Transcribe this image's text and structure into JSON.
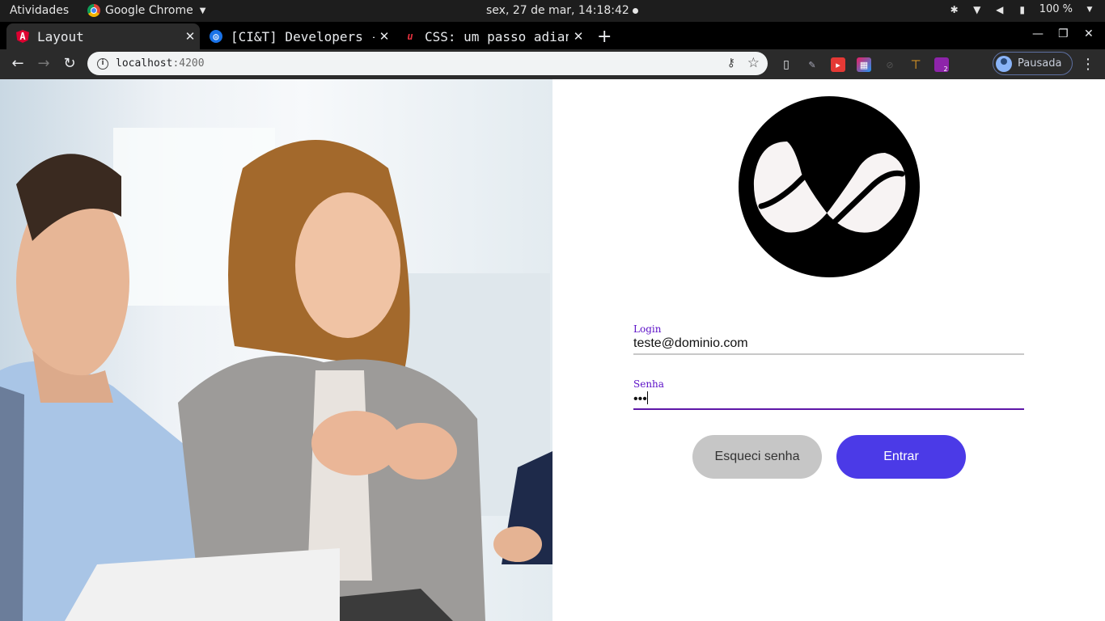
{
  "topbar": {
    "activities": "Atividades",
    "app_name": "Google Chrome",
    "clock": "sex, 27 de mar, 14:18:42",
    "battery": "100 %"
  },
  "tabs": [
    {
      "title": "Layout",
      "favicon": "angular-icon",
      "active": true
    },
    {
      "title": "[CI&T] Developers - ",
      "favicon": "cit-icon",
      "active": false
    },
    {
      "title": "CSS: um passo adian",
      "favicon": "alura-icon",
      "active": false
    }
  ],
  "address_bar": {
    "host": "localhost",
    "port": ":4200"
  },
  "profile": {
    "label": "Pausada"
  },
  "extensions": {
    "badge_count": "2"
  },
  "login_form": {
    "login_label": "Login",
    "login_value": "teste@dominio.com",
    "password_label": "Senha",
    "password_value": "•••",
    "forgot_button": "Esqueci senha",
    "enter_button": "Entrar"
  },
  "colors": {
    "accent_purple": "#5b0fc7",
    "primary_button": "#4b3ae7",
    "secondary_button": "#c6c6c6"
  }
}
